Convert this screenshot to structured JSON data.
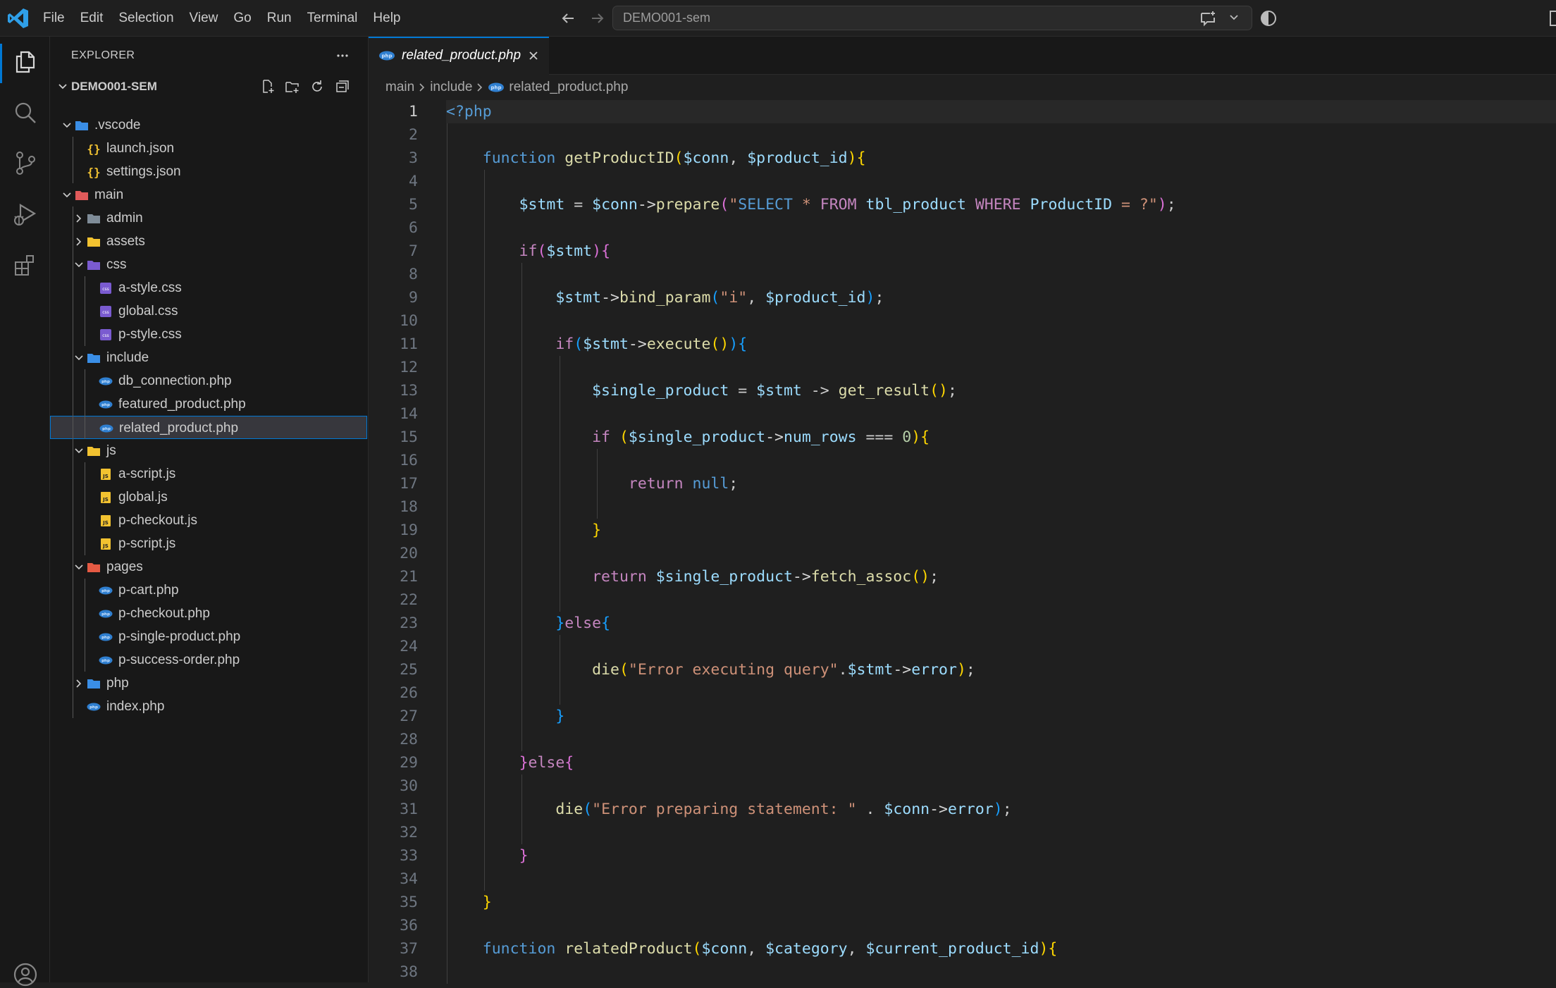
{
  "titlebar": {
    "menu": [
      "File",
      "Edit",
      "Selection",
      "View",
      "Go",
      "Run",
      "Terminal",
      "Help"
    ],
    "command_center": "DEMO001-sem"
  },
  "activity_bar": {
    "items": [
      "files-icon",
      "search-icon",
      "source-control-icon",
      "run-debug-icon",
      "extensions-icon",
      "account-icon"
    ]
  },
  "sidebar": {
    "title": "EXPLORER",
    "folder": "DEMO001-SEM",
    "tree": [
      {
        "label": ".vscode",
        "kind": "folder-vscode",
        "depth": 0,
        "expanded": true
      },
      {
        "label": "launch.json",
        "kind": "json",
        "depth": 1
      },
      {
        "label": "settings.json",
        "kind": "json",
        "depth": 1
      },
      {
        "label": "main",
        "kind": "folder-main",
        "depth": 0,
        "expanded": true
      },
      {
        "label": "admin",
        "kind": "folder-admin",
        "depth": 1,
        "expanded": false
      },
      {
        "label": "assets",
        "kind": "folder-assets",
        "depth": 1,
        "expanded": false
      },
      {
        "label": "css",
        "kind": "folder-css",
        "depth": 1,
        "expanded": true
      },
      {
        "label": "a-style.css",
        "kind": "css",
        "depth": 2
      },
      {
        "label": "global.css",
        "kind": "css",
        "depth": 2
      },
      {
        "label": "p-style.css",
        "kind": "css",
        "depth": 2
      },
      {
        "label": "include",
        "kind": "folder-include",
        "depth": 1,
        "expanded": true
      },
      {
        "label": "db_connection.php",
        "kind": "php",
        "depth": 2
      },
      {
        "label": "featured_product.php",
        "kind": "php",
        "depth": 2
      },
      {
        "label": "related_product.php",
        "kind": "php",
        "depth": 2,
        "selected": true
      },
      {
        "label": "js",
        "kind": "folder-js",
        "depth": 1,
        "expanded": true
      },
      {
        "label": "a-script.js",
        "kind": "js",
        "depth": 2
      },
      {
        "label": "global.js",
        "kind": "js",
        "depth": 2
      },
      {
        "label": "p-checkout.js",
        "kind": "js",
        "depth": 2
      },
      {
        "label": "p-script.js",
        "kind": "js",
        "depth": 2
      },
      {
        "label": "pages",
        "kind": "folder-pages",
        "depth": 1,
        "expanded": true
      },
      {
        "label": "p-cart.php",
        "kind": "php",
        "depth": 2
      },
      {
        "label": "p-checkout.php",
        "kind": "php",
        "depth": 2
      },
      {
        "label": "p-single-product.php",
        "kind": "php",
        "depth": 2
      },
      {
        "label": "p-success-order.php",
        "kind": "php",
        "depth": 2
      },
      {
        "label": "php",
        "kind": "folder-php",
        "depth": 1,
        "expanded": false
      },
      {
        "label": "index.php",
        "kind": "php",
        "depth": 1
      }
    ]
  },
  "editor": {
    "tab": "related_product.php",
    "breadcrumb": [
      "main",
      "include",
      "related_product.php"
    ],
    "current_line": 1,
    "lines": [
      [
        [
          "ph",
          "<?php"
        ]
      ],
      [],
      [
        [
          "pl",
          "    "
        ],
        [
          "kw",
          "function"
        ],
        [
          "pl",
          " "
        ],
        [
          "f",
          "getProductID"
        ],
        [
          "b1",
          "("
        ],
        [
          "v",
          "$conn"
        ],
        [
          "pl",
          ", "
        ],
        [
          "v",
          "$product_id"
        ],
        [
          "b1",
          ")"
        ],
        [
          "b1",
          "{"
        ]
      ],
      [],
      [
        [
          "pl",
          "        "
        ],
        [
          "v",
          "$stmt"
        ],
        [
          "pl",
          " = "
        ],
        [
          "v",
          "$conn"
        ],
        [
          "op",
          "->"
        ],
        [
          "f",
          "prepare"
        ],
        [
          "b2",
          "("
        ],
        [
          "s",
          "\""
        ],
        [
          "sq",
          "SELECT"
        ],
        [
          "s",
          " * "
        ],
        [
          "k",
          "FROM"
        ],
        [
          "s",
          " "
        ],
        [
          "v",
          "tbl_product"
        ],
        [
          "s",
          " "
        ],
        [
          "k",
          "WHERE"
        ],
        [
          "s",
          " "
        ],
        [
          "v",
          "ProductID"
        ],
        [
          "s",
          " = ?\""
        ],
        [
          "b2",
          ")"
        ],
        [
          "pl",
          ";"
        ]
      ],
      [],
      [
        [
          "pl",
          "        "
        ],
        [
          "k",
          "if"
        ],
        [
          "b2",
          "("
        ],
        [
          "v",
          "$stmt"
        ],
        [
          "b2",
          ")"
        ],
        [
          "b2",
          "{"
        ]
      ],
      [],
      [
        [
          "pl",
          "            "
        ],
        [
          "v",
          "$stmt"
        ],
        [
          "op",
          "->"
        ],
        [
          "f",
          "bind_param"
        ],
        [
          "b3",
          "("
        ],
        [
          "s",
          "\"i\""
        ],
        [
          "pl",
          ", "
        ],
        [
          "v",
          "$product_id"
        ],
        [
          "b3",
          ")"
        ],
        [
          "pl",
          ";"
        ]
      ],
      [],
      [
        [
          "pl",
          "            "
        ],
        [
          "k",
          "if"
        ],
        [
          "b3",
          "("
        ],
        [
          "v",
          "$stmt"
        ],
        [
          "op",
          "->"
        ],
        [
          "f",
          "execute"
        ],
        [
          "b1",
          "()"
        ],
        [
          "b3",
          ")"
        ],
        [
          "b3",
          "{"
        ]
      ],
      [],
      [
        [
          "pl",
          "                "
        ],
        [
          "v",
          "$single_product"
        ],
        [
          "pl",
          " = "
        ],
        [
          "v",
          "$stmt"
        ],
        [
          "pl",
          " -> "
        ],
        [
          "f",
          "get_result"
        ],
        [
          "b1",
          "()"
        ],
        [
          "pl",
          ";"
        ]
      ],
      [],
      [
        [
          "pl",
          "                "
        ],
        [
          "k",
          "if"
        ],
        [
          "pl",
          " "
        ],
        [
          "b1",
          "("
        ],
        [
          "v",
          "$single_product"
        ],
        [
          "op",
          "->"
        ],
        [
          "v",
          "num_rows"
        ],
        [
          "pl",
          " === "
        ],
        [
          "num",
          "0"
        ],
        [
          "b1",
          ")"
        ],
        [
          "b1",
          "{"
        ]
      ],
      [],
      [
        [
          "pl",
          "                    "
        ],
        [
          "k",
          "return"
        ],
        [
          "pl",
          " "
        ],
        [
          "kw",
          "null"
        ],
        [
          "pl",
          ";"
        ]
      ],
      [],
      [
        [
          "pl",
          "                "
        ],
        [
          "b1",
          "}"
        ]
      ],
      [],
      [
        [
          "pl",
          "                "
        ],
        [
          "k",
          "return"
        ],
        [
          "pl",
          " "
        ],
        [
          "v",
          "$single_product"
        ],
        [
          "op",
          "->"
        ],
        [
          "f",
          "fetch_assoc"
        ],
        [
          "b1",
          "()"
        ],
        [
          "pl",
          ";"
        ]
      ],
      [],
      [
        [
          "pl",
          "            "
        ],
        [
          "b3",
          "}"
        ],
        [
          "k",
          "else"
        ],
        [
          "b3",
          "{"
        ]
      ],
      [],
      [
        [
          "pl",
          "                "
        ],
        [
          "f",
          "die"
        ],
        [
          "b1",
          "("
        ],
        [
          "s",
          "\"Error executing query\""
        ],
        [
          "pl",
          "."
        ],
        [
          "v",
          "$stmt"
        ],
        [
          "op",
          "->"
        ],
        [
          "v",
          "error"
        ],
        [
          "b1",
          ")"
        ],
        [
          "pl",
          ";"
        ]
      ],
      [],
      [
        [
          "pl",
          "            "
        ],
        [
          "b3",
          "}"
        ]
      ],
      [],
      [
        [
          "pl",
          "        "
        ],
        [
          "b2",
          "}"
        ],
        [
          "k",
          "else"
        ],
        [
          "b2",
          "{"
        ]
      ],
      [],
      [
        [
          "pl",
          "            "
        ],
        [
          "f",
          "die"
        ],
        [
          "b3",
          "("
        ],
        [
          "s",
          "\"Error preparing statement: \""
        ],
        [
          "pl",
          " . "
        ],
        [
          "v",
          "$conn"
        ],
        [
          "op",
          "->"
        ],
        [
          "v",
          "error"
        ],
        [
          "b3",
          ")"
        ],
        [
          "pl",
          ";"
        ]
      ],
      [],
      [
        [
          "pl",
          "        "
        ],
        [
          "b2",
          "}"
        ]
      ],
      [],
      [
        [
          "pl",
          "    "
        ],
        [
          "b1",
          "}"
        ]
      ],
      [],
      [
        [
          "pl",
          "    "
        ],
        [
          "kw",
          "function"
        ],
        [
          "pl",
          " "
        ],
        [
          "f",
          "relatedProduct"
        ],
        [
          "b1",
          "("
        ],
        [
          "v",
          "$conn"
        ],
        [
          "pl",
          ", "
        ],
        [
          "v",
          "$category"
        ],
        [
          "pl",
          ", "
        ],
        [
          "v",
          "$current_product_id"
        ],
        [
          "b1",
          ")"
        ],
        [
          "b1",
          "{"
        ]
      ],
      []
    ]
  }
}
